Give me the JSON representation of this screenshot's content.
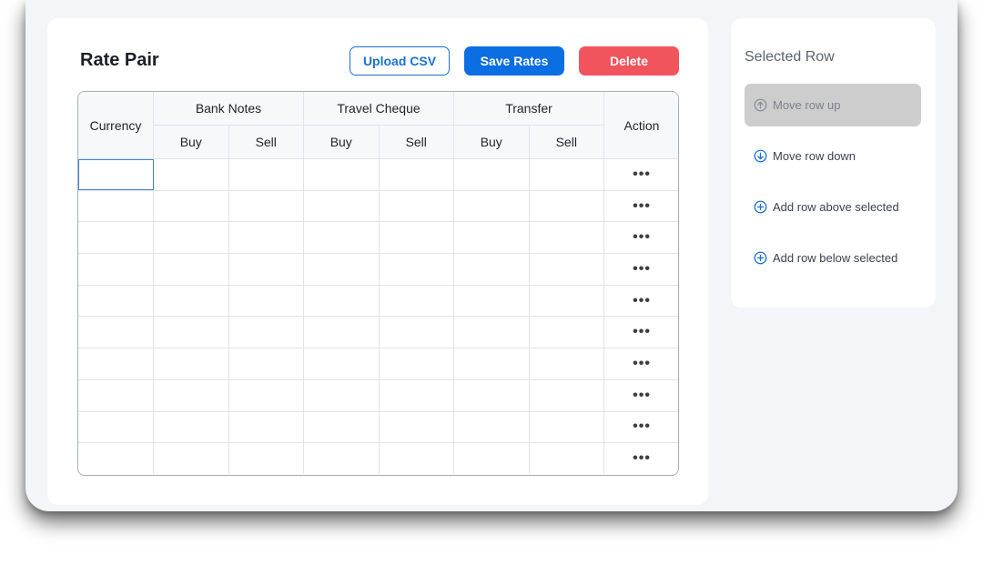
{
  "header": {
    "title": "Rate Pair",
    "upload_label": "Upload CSV",
    "save_label": "Save Rates",
    "delete_label": "Delete"
  },
  "table": {
    "col_currency": "Currency",
    "groups": [
      "Bank Notes",
      "Travel Cheque",
      "Transfer"
    ],
    "sub_buy": "Buy",
    "sub_sell": "Sell",
    "col_action": "Action",
    "row_count": 10,
    "action_glyph": "•••"
  },
  "side": {
    "title": "Selected Row",
    "items": [
      {
        "label": "Move row up",
        "icon": "arrow-up-circle-icon",
        "disabled": true
      },
      {
        "label": "Move row down",
        "icon": "arrow-down-circle-icon",
        "disabled": false
      },
      {
        "label": "Add row above selected",
        "icon": "plus-circle-icon",
        "disabled": false
      },
      {
        "label": "Add row below selected",
        "icon": "plus-circle-icon",
        "disabled": false
      }
    ]
  },
  "colors": {
    "primary": "#0b6ee3",
    "danger": "#f2545e",
    "disabled_bg": "#cdcdcd"
  }
}
